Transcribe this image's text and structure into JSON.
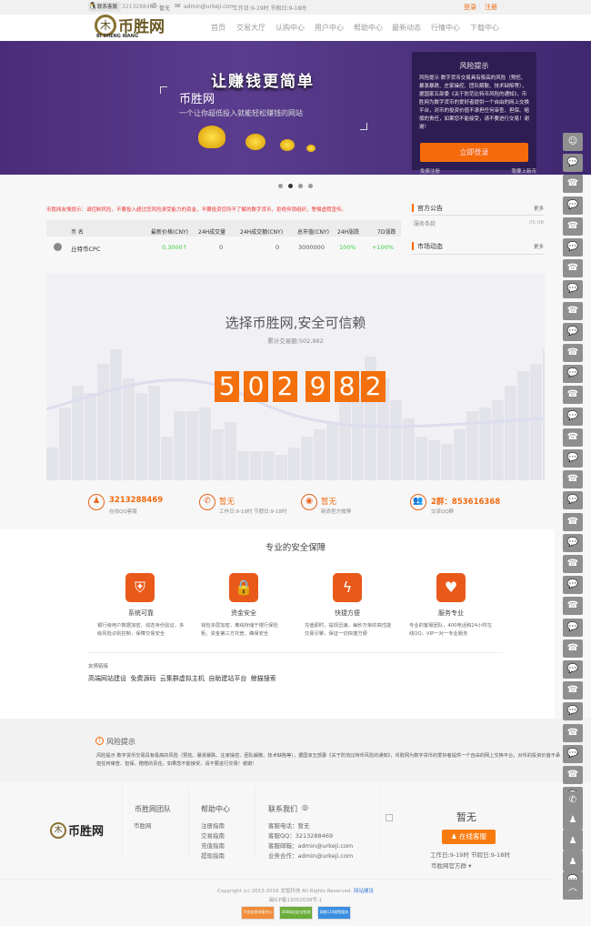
{
  "topbar": {
    "qq_label": "联系客服",
    "qq_number": "3213288469",
    "phone": "暂无",
    "email": "admin@urkeji.com",
    "hours": "工作日:9-19时 节假日:9-18时",
    "login": "登录",
    "register": "注册"
  },
  "logo": {
    "text": "币胜网",
    "sub": "BI SHENG WANG"
  },
  "nav": [
    "首页",
    "交易大厅",
    "认购中心",
    "用户中心",
    "帮助中心",
    "最新动态",
    "行情中心",
    "下载中心"
  ],
  "banner": {
    "headline": "让赚钱更简单",
    "brand": "币胜网",
    "tagline": "一个让你超低投入就能轻松赚钱的网站",
    "risk_title": "风险提示",
    "risk_text": "风险提示 数字货币交易具有极高的风险（预挖、暴涨暴跌、庄家操控、团队解散、技术缺陷等），据国家五部委《关于防范比特币风险的通知》，币胜网为数字货币的爱好者提供一个自由的网上交换平台，对币的投资价值不承担任何审查、担保、赔偿的责任，如果您不能接受，请不要进行交易！谢谢！",
    "login_button": "立即登录",
    "free_register": "免费注册",
    "apply_listing": "我要上新币"
  },
  "notice": "币胜网友情提示：请控制风险，不要投入超过您风险承受能力的资金，不要投资您所不了解的数字货币，拒绝传销组织，警惕虚假宣传。",
  "market_table": {
    "headers": [
      "币 名",
      "最新价格(CNY)",
      "24H成交量",
      "24H成交额(CNY)",
      "总市值(CNY)",
      "24H涨跌",
      "7D涨跌"
    ],
    "rows": [
      {
        "name": "丘特币CPC",
        "price": "0.3000↑",
        "volume": "0",
        "amount": "0",
        "cap": "3000000",
        "change24": "100%",
        "change7": "+100%"
      }
    ]
  },
  "side": {
    "announce_title": "官方公告",
    "more": "更多",
    "announce_items": [
      {
        "title": "服务条款",
        "date": "05-08"
      }
    ],
    "market_title": "市场动态"
  },
  "stats": {
    "title": "选择币胜网,安全可信赖",
    "subtitle": "累计交易额:502,982",
    "digits": [
      "5",
      "0",
      "2",
      "9",
      "8",
      "2"
    ]
  },
  "contacts": [
    {
      "main": "3213288469",
      "sub": "在线QQ客服"
    },
    {
      "main": "暂无",
      "sub": "工作日:9-19时 节假日:9-18时"
    },
    {
      "main": "暂无",
      "sub": "新浪官方微博"
    },
    {
      "main": "2群：853616368",
      "sub": "交流QQ群"
    }
  ],
  "security": {
    "title": "专业的安全保障",
    "features": [
      {
        "title": "系统可靠",
        "desc": "银行级用户数据加密、动态身份验证，多级风险识别控制，保障交易安全"
      },
      {
        "title": "资金安全",
        "desc": "钱包多层加密，离线存储于银行保险柜，资金第三方托管，确保安全"
      },
      {
        "title": "快捷方便",
        "desc": "充值即时、提现迅速，每秒万单的高性能交易引擎，保证一切快捷方便"
      },
      {
        "title": "服务专业",
        "desc": "专业的客服团队，400电话和24小时在线QQ，VIP一对一专业服务"
      }
    ]
  },
  "links": {
    "title": "友情链接",
    "items": [
      "高端网站建设",
      "免费源码",
      "云集群虚拟主机",
      "自助建站平台",
      "鲸猫搜索"
    ]
  },
  "risk": {
    "title": "风险提示",
    "text": "风险提示 数字货币交易具有极高的风险（预挖、暴涨暴跌、庄家操控、团队解散、技术缺陷等），据国家五部委《关于防范比特币风险的通知》，币胜网为数字货币的爱好者提供一个自由的网上交换平台，对币的投资价值不承担任何审查、担保、赔偿的责任，如果您不能接受，请不要进行交易！谢谢！"
  },
  "footer": {
    "team_title": "币胜网团队",
    "team_items": [
      "币胜网"
    ],
    "help_title": "帮助中心",
    "help_items": [
      "注册指南",
      "交易指南",
      "充值指南",
      "提现指南"
    ],
    "contact_title": "联系我们",
    "contact_items": [
      "客服电话：暂无",
      "客服QQ：3213288469",
      "客服邮箱：admin@urkeji.com",
      "业务合作：admin@urkeji.com"
    ],
    "phone": "暂无",
    "online_service": "在线客服",
    "hours": "工作日:9-19时 节假日:9-18时",
    "group": "币胜网官方群",
    "copyright": "Copyright (c) 2013-2016 龙智科技 All Rights Reserved.",
    "site_build": "网站建设",
    "icp": "闽ICP备13052038号-1",
    "badges": [
      "不良信息举报中心",
      "360网站安全检测",
      "网络110报警服务"
    ]
  },
  "sidebar_icons": [
    "service",
    "wechat",
    "phone",
    "wechat",
    "phone",
    "wechat",
    "phone",
    "wechat",
    "phone",
    "wechat",
    "phone",
    "wechat",
    "phone",
    "wechat",
    "phone",
    "wechat",
    "phone",
    "wechat",
    "phone",
    "wechat",
    "phone",
    "wechat",
    "phone",
    "wechat",
    "phone",
    "wechat",
    "phone",
    "wechat",
    "phone",
    "wechat",
    "phone",
    "wechat",
    "phone",
    "wechat",
    "phone",
    "wechat",
    "call",
    "qq1",
    "qq2",
    "qq3",
    "top"
  ]
}
